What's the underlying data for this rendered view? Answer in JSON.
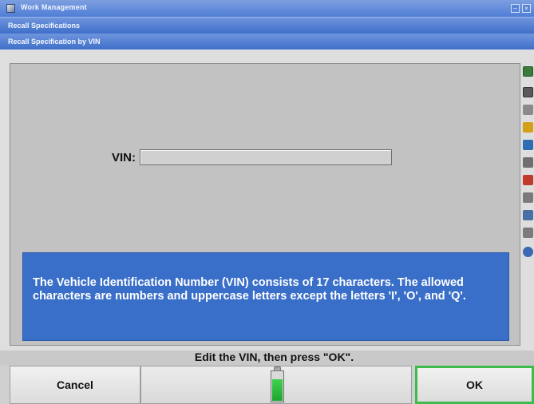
{
  "window": {
    "title": "Work Management",
    "breadcrumb": [
      "Recall Specifications",
      "Recall Specification by VIN"
    ]
  },
  "form": {
    "vin_label": "VIN:",
    "vin_value": ""
  },
  "info": {
    "text": "The Vehicle Identification Number (VIN) consists of 17 characters. The allowed characters are numbers and uppercase letters except the letters 'I', 'O', and 'Q'."
  },
  "prompt": "Edit the VIN, then press \"OK\".",
  "buttons": {
    "cancel": "Cancel",
    "ok": "OK"
  },
  "gauge": {
    "level": 0.7
  },
  "toolbar_icons": [
    {
      "name": "help-icon",
      "color": "#3a7a3a"
    },
    {
      "name": "photo-icon",
      "color": "#5a5a5a"
    },
    {
      "name": "tools-icon",
      "color": "#8a8a8a"
    },
    {
      "name": "alert-icon",
      "color": "#d4a017"
    },
    {
      "name": "target-icon",
      "color": "#2f6db3"
    },
    {
      "name": "gauge-icon",
      "color": "#6f6f6f"
    },
    {
      "name": "car-icon",
      "color": "#c0392b"
    },
    {
      "name": "print-icon",
      "color": "#7a7a7a"
    },
    {
      "name": "lift-icon",
      "color": "#4a6fa5"
    },
    {
      "name": "list-icon",
      "color": "#7b7b7b"
    },
    {
      "name": "globe-icon",
      "color": "#3b67b3"
    }
  ]
}
